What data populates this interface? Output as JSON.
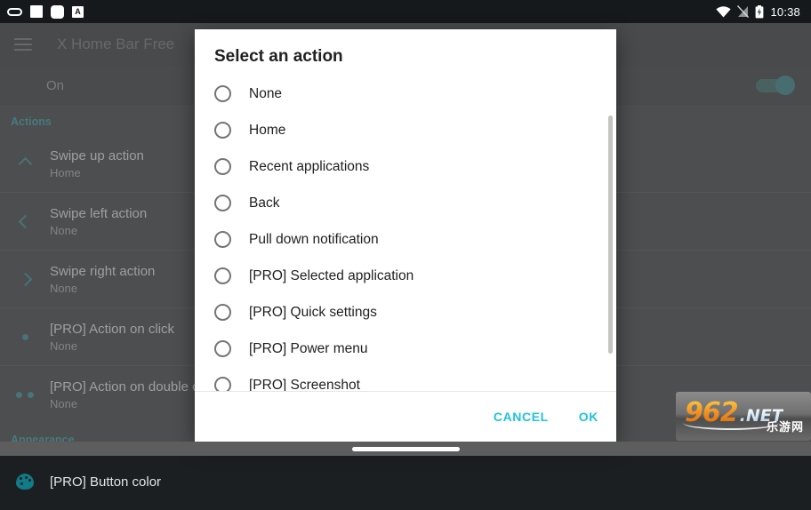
{
  "status_bar": {
    "left_icons": [
      "capsule-icon",
      "square-icon",
      "rounded-square-icon",
      "a-box-icon"
    ],
    "a_box_label": "A",
    "right_icons": [
      "wifi-icon",
      "no-sim-icon",
      "battery-charging-icon"
    ],
    "time": "10:38"
  },
  "action_bar": {
    "menu_icon": "hamburger-icon",
    "title": "X Home Bar Free"
  },
  "master_switch": {
    "label": "On",
    "enabled": true
  },
  "settings": {
    "sections": [
      {
        "title": "Actions",
        "items": [
          {
            "icon": "chevron-up-icon",
            "title": "Swipe up action",
            "value": "Home"
          },
          {
            "icon": "chevron-left-icon",
            "title": "Swipe left action",
            "value": "None"
          },
          {
            "icon": "chevron-right-icon",
            "title": "Swipe right action",
            "value": "None"
          },
          {
            "icon": "dot-icon",
            "title": "[PRO] Action on click",
            "value": "None"
          },
          {
            "icon": "double-dot-icon",
            "title": "[PRO] Action on double click",
            "value": "None"
          }
        ]
      },
      {
        "title": "Appearance",
        "items": [
          {
            "icon": "palette-icon",
            "title": "[PRO] Button color",
            "value": ""
          }
        ]
      }
    ]
  },
  "dialog": {
    "title": "Select an action",
    "options": [
      {
        "label": "None",
        "selected": false
      },
      {
        "label": "Home",
        "selected": false
      },
      {
        "label": "Recent applications",
        "selected": false
      },
      {
        "label": "Back",
        "selected": false
      },
      {
        "label": "Pull down notification",
        "selected": false
      },
      {
        "label": "[PRO] Selected application",
        "selected": false
      },
      {
        "label": "[PRO] Quick settings",
        "selected": false
      },
      {
        "label": "[PRO] Power menu",
        "selected": false
      },
      {
        "label": "[PRO] Screenshot",
        "selected": false
      }
    ],
    "cancel_label": "CANCEL",
    "ok_label": "OK",
    "accent_color": "#23c2dd"
  },
  "watermark": {
    "number": "962",
    "domain": ".NET",
    "chinese": "乐游网"
  },
  "nav_bar": {
    "gesture_pill": "home-gesture-pill"
  },
  "theme": {
    "accent_teal": "#0f7c87",
    "dialog_accent": "#23c2dd",
    "app_background": "#1b1f22"
  }
}
